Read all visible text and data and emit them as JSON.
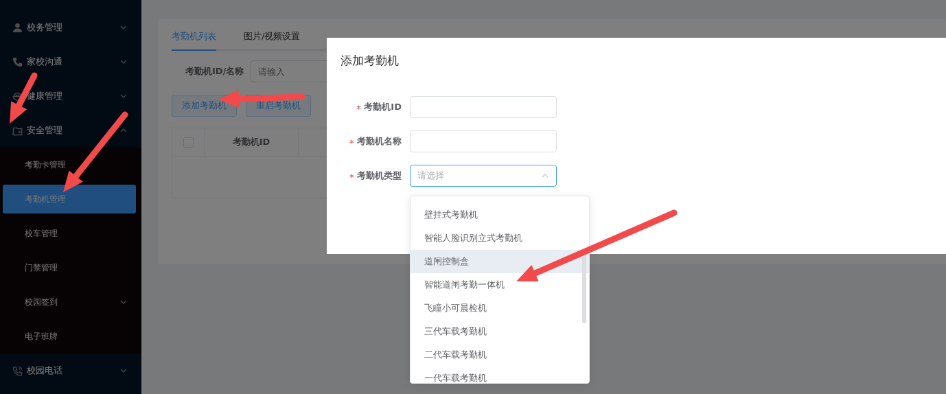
{
  "sidebar": {
    "items": [
      {
        "label": "校务管理",
        "expanded": false
      },
      {
        "label": "家校沟通",
        "expanded": false
      },
      {
        "label": "健康管理",
        "expanded": false
      },
      {
        "label": "安全管理",
        "expanded": true,
        "children": [
          {
            "label": "考勤卡管理",
            "selected": false,
            "has_children": false
          },
          {
            "label": "考勤机管理",
            "selected": true,
            "has_children": false
          },
          {
            "label": "校车管理",
            "selected": false,
            "has_children": false
          },
          {
            "label": "门禁管理",
            "selected": false,
            "has_children": false
          },
          {
            "label": "校园签到",
            "selected": false,
            "has_children": true
          },
          {
            "label": "电子班牌",
            "selected": false,
            "has_children": false
          }
        ]
      },
      {
        "label": "校园电话",
        "expanded": false
      }
    ]
  },
  "tabs": [
    {
      "label": "考勤机列表",
      "selected": true
    },
    {
      "label": "图片/视频设置",
      "selected": false
    }
  ],
  "filter": {
    "label": "考勤机ID/名称",
    "placeholder": "请输入"
  },
  "buttons": [
    "添加考勤机",
    "重启考勤机"
  ],
  "table": {
    "select_all_checked": false,
    "columns": [
      "考勤机ID"
    ]
  },
  "dialog": {
    "title": "添加考勤机",
    "fields": [
      {
        "label": "考勤机ID",
        "required": true,
        "kind": "input"
      },
      {
        "label": "考勤机名称",
        "required": true,
        "kind": "input"
      },
      {
        "label": "考勤机类型",
        "required": true,
        "kind": "select",
        "placeholder": "请选择",
        "expanded": true
      }
    ]
  },
  "dropdown": {
    "options": [
      {
        "label": "壁挂式考勤机",
        "hovered": false
      },
      {
        "label": "智能人脸识别立式考勤机",
        "hovered": false
      },
      {
        "label": "道闸控制盒",
        "hovered": true
      },
      {
        "label": "智能道闸考勤一体机",
        "hovered": false
      },
      {
        "label": "飞瞳小可晨检机",
        "hovered": false
      },
      {
        "label": "三代车载考勤机",
        "hovered": false
      },
      {
        "label": "二代车载考勤机",
        "hovered": false
      },
      {
        "label": "一代车载考勤机",
        "hovered": false
      }
    ]
  }
}
